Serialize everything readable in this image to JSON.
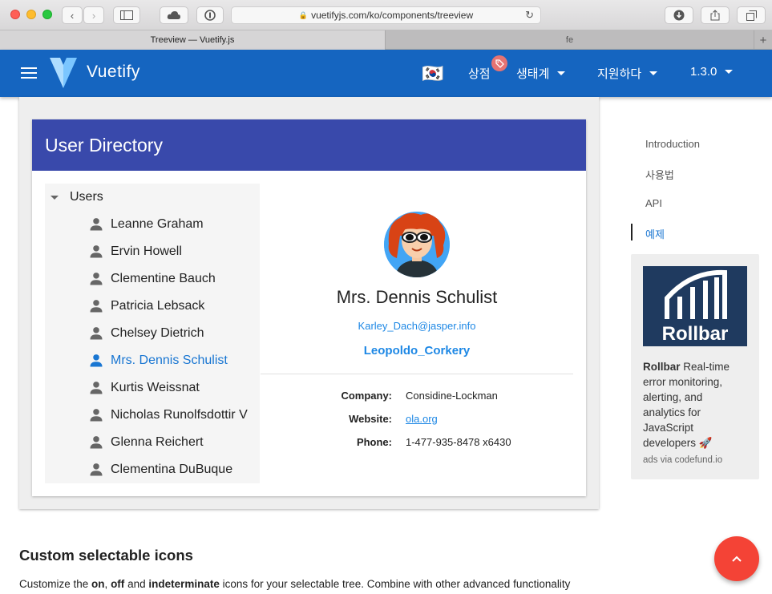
{
  "browser": {
    "url": "vuetifyjs.com/ko/components/treeview",
    "tabs": [
      {
        "label": "Treeview — Vuetify.js"
      },
      {
        "label": "fe"
      }
    ]
  },
  "appbar": {
    "brand": "Vuetify",
    "flag": "🇰🇷",
    "store_label": "상점",
    "ecosystem_label": "생태계",
    "support_label": "지원하다",
    "version_label": "1.3.0",
    "color": "#1565c0"
  },
  "card": {
    "title": "User Directory",
    "tree_root": "Users",
    "users": [
      {
        "name": "Leanne Graham"
      },
      {
        "name": "Ervin Howell"
      },
      {
        "name": "Clementine Bauch"
      },
      {
        "name": "Patricia Lebsack"
      },
      {
        "name": "Chelsey Dietrich"
      },
      {
        "name": "Mrs. Dennis Schulist",
        "active": true
      },
      {
        "name": "Kurtis Weissnat"
      },
      {
        "name": "Nicholas Runolfsdottir V"
      },
      {
        "name": "Glenna Reichert"
      },
      {
        "name": "Clementina DuBuque"
      }
    ],
    "selected": {
      "name": "Mrs. Dennis Schulist",
      "email": "Karley_Dach@jasper.info",
      "username": "Leopoldo_Corkery",
      "company_label": "Company:",
      "company": "Considine-Lockman",
      "website_label": "Website:",
      "website": "ola.org",
      "phone_label": "Phone:",
      "phone": "1-477-935-8478 x6430"
    }
  },
  "toc": {
    "items": [
      "Introduction",
      "사용법",
      "API",
      "예제"
    ],
    "active_index": 3
  },
  "ad": {
    "logo_text": "Rollbar",
    "brand": "Rollbar",
    "text": " Real-time error monitoring, alerting, and analytics for JavaScript developers 🚀",
    "via": "ads via codefund.io"
  },
  "section": {
    "title": "Custom selectable icons",
    "desc_parts": [
      "Customize the ",
      "on",
      ", ",
      "off",
      " and ",
      "indeterminate",
      " icons for your selectable tree. Combine with other advanced functionality"
    ]
  }
}
